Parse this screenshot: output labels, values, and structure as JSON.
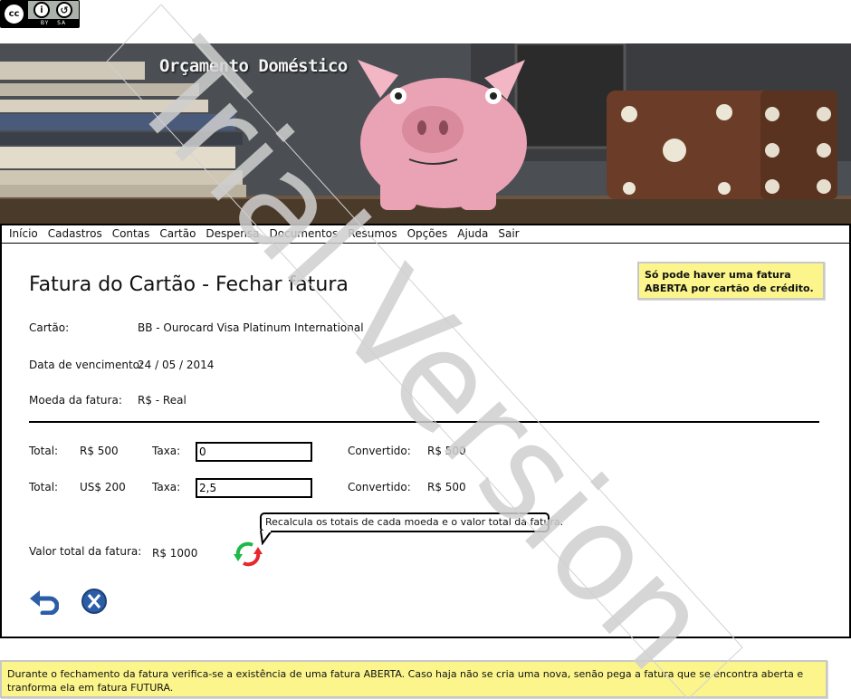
{
  "license": {
    "cc": "cc",
    "by": "BY",
    "sa": "SA"
  },
  "banner": {
    "title": "Orçamento Doméstico"
  },
  "menu": {
    "items": [
      "Início",
      "Cadastros",
      "Contas",
      "Cartão",
      "Despensa",
      "Documentos",
      "Resumos",
      "Opções",
      "Ajuda",
      "Sair"
    ]
  },
  "watermark": "Trial Version",
  "page": {
    "title": "Fatura do Cartão - Fechar fatura",
    "note": "Só pode haver uma fatura ABERTA por cartão de crédito.",
    "fields": {
      "cartao_label": "Cartão:",
      "cartao_value": "BB - Ourocard Visa Platinum International",
      "vencimento_label": "Data de vencimento:",
      "vencimento_value": "24 / 05 / 2014",
      "moeda_label": "Moeda da fatura:",
      "moeda_value": "R$ - Real"
    },
    "rows": [
      {
        "total_label": "Total:",
        "total_value": "R$ 500",
        "taxa_label": "Taxa:",
        "taxa_value": "0",
        "convertido_label": "Convertido:",
        "convertido_value": "R$ 500"
      },
      {
        "total_label": "Total:",
        "total_value": "US$ 200",
        "taxa_label": "Taxa:",
        "taxa_value": "2,5",
        "convertido_label": "Convertido:",
        "convertido_value": "R$ 500"
      }
    ],
    "total": {
      "label": "Valor total da fatura:",
      "value": "R$ 1000"
    },
    "callout": "Recalcula os totais de cada moeda e o valor total da fatura.",
    "icons": {
      "recalc": "refresh-icon",
      "undo": "undo-icon",
      "cancel": "close-icon"
    }
  },
  "bottom_note": "Durante o fechamento da fatura verifica-se a existência de uma fatura ABERTA. Caso haja não se cria uma nova, senão pega a fatura que se encontra aberta e tranforma ela em fatura FUTURA.",
  "colors": {
    "note_bg": "#fbf58c",
    "refresh_green": "#1fb84a",
    "refresh_red": "#e8262c",
    "button_blue": "#2c5ea8"
  }
}
